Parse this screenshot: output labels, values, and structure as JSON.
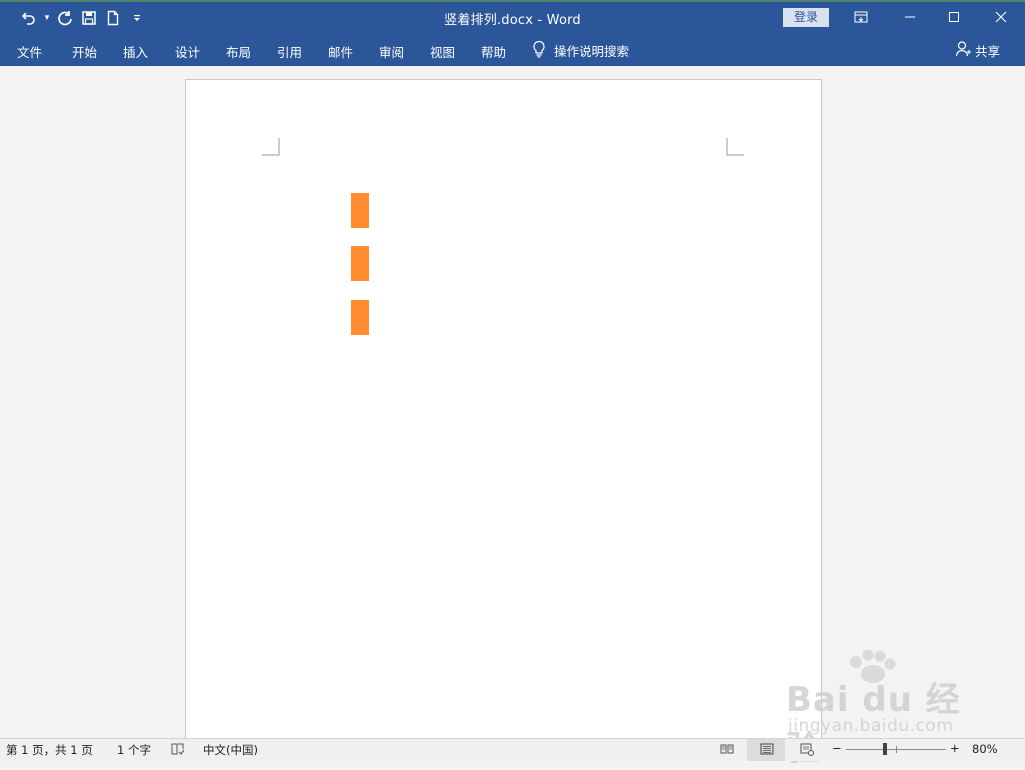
{
  "window": {
    "title": "竖着排列.docx  -  Word",
    "login_label": "登录",
    "accent": "#2b579a"
  },
  "quick_access": {
    "icons": [
      "undo-icon",
      "redo-icon",
      "save-icon",
      "new-document-icon",
      "customize-qat-icon"
    ]
  },
  "tabs": [
    {
      "label": "文件"
    },
    {
      "label": "开始"
    },
    {
      "label": "插入"
    },
    {
      "label": "设计"
    },
    {
      "label": "布局"
    },
    {
      "label": "引用"
    },
    {
      "label": "邮件"
    },
    {
      "label": "审阅"
    },
    {
      "label": "视图"
    },
    {
      "label": "帮助"
    }
  ],
  "tell_me": {
    "label": "操作说明搜索",
    "icon": "lightbulb-icon"
  },
  "share": {
    "label": "共享",
    "icon": "person-icon"
  },
  "document": {
    "shapes": [
      {
        "name": "orange-rectangle-1",
        "color": "#ff8c2f"
      },
      {
        "name": "orange-rectangle-2",
        "color": "#ff8c2f"
      },
      {
        "name": "orange-rectangle-3",
        "color": "#ff8c2f"
      }
    ]
  },
  "status": {
    "page": "第 1 页，共 1 页",
    "words": "1 个字",
    "language": "中文(中国)",
    "zoom": "80%",
    "zoom_minus": "−",
    "zoom_plus": "+"
  },
  "watermark": {
    "main": "Bai du 经验",
    "sub": "jingyan.baidu.com"
  }
}
